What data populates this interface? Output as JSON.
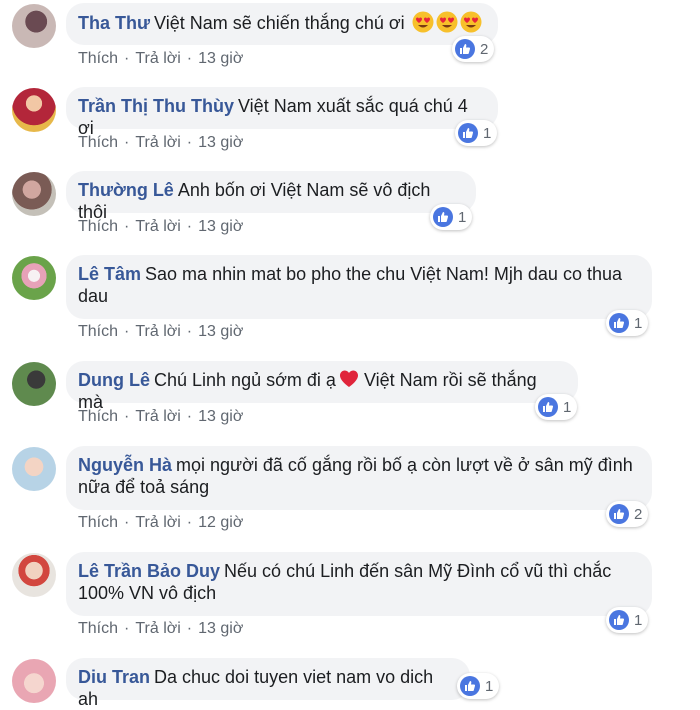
{
  "actions": {
    "like": "Thích",
    "reply": "Trả lời",
    "dot": "·"
  },
  "comments": [
    {
      "author": "Tha Thư",
      "text": "Việt Nam sẽ chiến thắng chú ơi",
      "emoji": [
        "heart-eyes",
        "heart-eyes",
        "heart-eyes"
      ],
      "likes": "2",
      "time": "13 giờ"
    },
    {
      "author": "Trần Thị Thu Thùy",
      "text": "Việt Nam xuất sắc quá chú 4 ơi",
      "likes": "1",
      "time": "13 giờ"
    },
    {
      "author": "Thường Lê",
      "text": "Anh bốn ơi Việt Nam sẽ vô địch thôi",
      "likes": "1",
      "time": "13 giờ"
    },
    {
      "author": "Lê Tâm",
      "text": "Sao ma nhin mat bo pho the chu Việt Nam! Mjh dau co thua",
      "text2": "dau",
      "likes": "1",
      "time": "13 giờ"
    },
    {
      "author": "Dung Lê",
      "text": "Chú Linh ngủ sớm đi ạ",
      "text_after_heart": "Việt Nam rồi sẽ thắng mà",
      "likes": "1",
      "time": "13 giờ"
    },
    {
      "author": "Nguyễn Hà",
      "text": "mọi người đã cố gắng rồi bố ạ còn lượt về ở sân mỹ đình",
      "text2": "nữa để toả sáng",
      "likes": "2",
      "time": "12 giờ"
    },
    {
      "author": "Lê Trần Bảo Duy",
      "text": "Nếu có chú Linh đến sân Mỹ Đình cổ vũ thì chắc",
      "text2": "100% VN vô địch",
      "likes": "1",
      "time": "13 giờ"
    },
    {
      "author": "Diu Tran",
      "text": "Da chuc doi tuyen viet nam vo dich ah",
      "likes": "1"
    }
  ],
  "colors": {
    "author": "#385898",
    "bubble": "#f2f3f5",
    "like_badge": "#4a76e0",
    "meta": "#606770"
  }
}
